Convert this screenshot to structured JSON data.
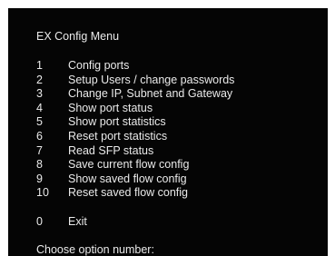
{
  "menu": {
    "title": "EX Config Menu",
    "items": [
      {
        "number": "1",
        "label": "Config ports"
      },
      {
        "number": "2",
        "label": "Setup Users / change passwords"
      },
      {
        "number": "3",
        "label": "Change IP, Subnet and Gateway"
      },
      {
        "number": "4",
        "label": "Show port status"
      },
      {
        "number": "5",
        "label": "Show port statistics"
      },
      {
        "number": "6",
        "label": "Reset port statistics"
      },
      {
        "number": "7",
        "label": "Read SFP status"
      },
      {
        "number": "8",
        "label": "Save current flow config"
      },
      {
        "number": "9",
        "label": "Show saved flow config"
      },
      {
        "number": "10",
        "label": "Reset saved flow config"
      }
    ],
    "exit": {
      "number": "0",
      "label": "Exit"
    },
    "prompt": "Choose option number:"
  },
  "colors": {
    "background": "#050505",
    "text": "#eaeaea"
  }
}
